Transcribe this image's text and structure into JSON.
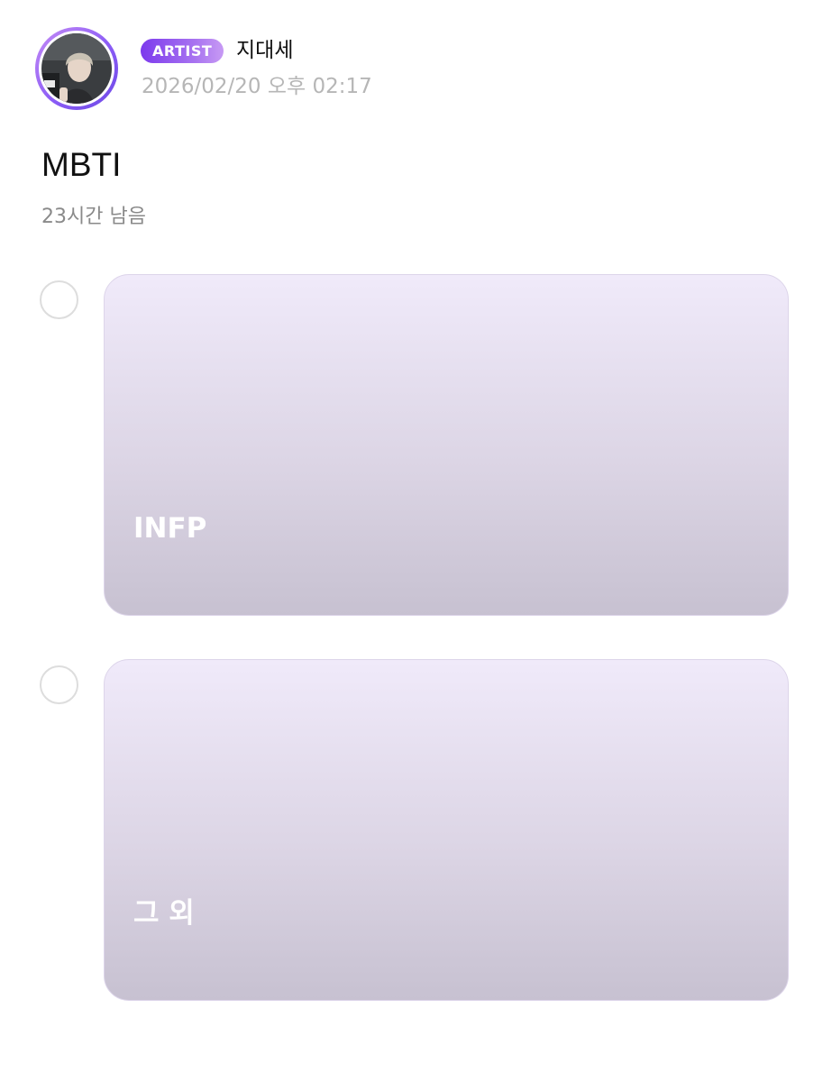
{
  "post": {
    "badge": "ARTIST",
    "author_name": "지대세",
    "date": "2026/02/20 오후 02:17"
  },
  "poll": {
    "title": "MBTI",
    "remaining": "23시간 남음",
    "options": [
      {
        "label": "INFP",
        "selected": false
      },
      {
        "label": "그 외",
        "selected": false
      }
    ]
  },
  "colors": {
    "accent": "#7c3aed",
    "date_text": "#b6b6b6",
    "remaining_text": "#8a8a8a",
    "card_top": "#f0eafa",
    "card_bottom": "#c7c1d1"
  }
}
